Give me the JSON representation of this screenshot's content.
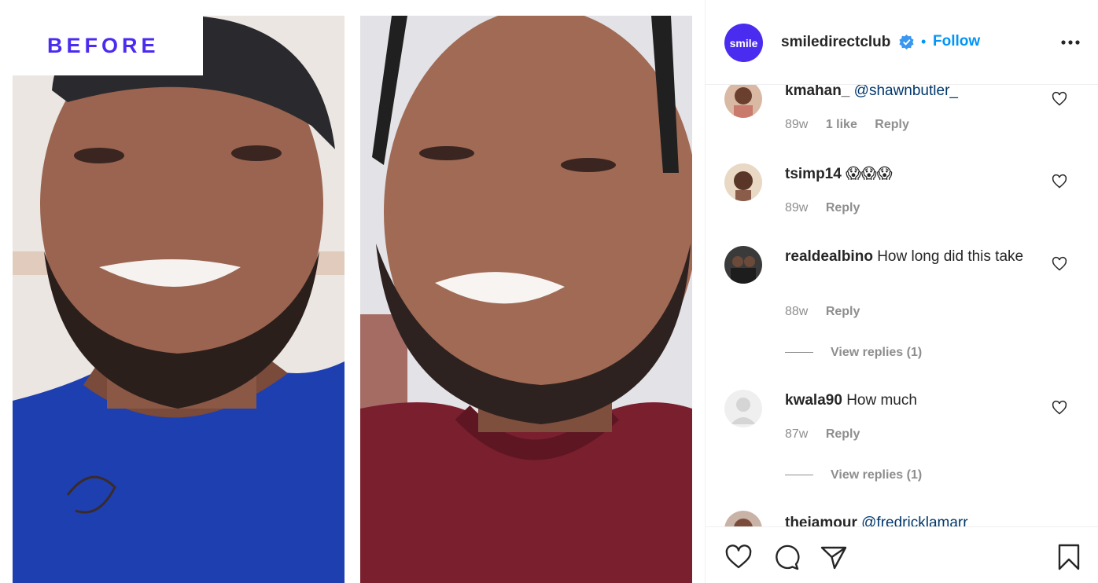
{
  "media": {
    "before_label": "BEFORE"
  },
  "header": {
    "avatar_text": "smile",
    "username": "smiledirectclub",
    "separator": "•",
    "follow_label": "Follow",
    "brand_color": "#4a2cf0",
    "link_color": "#0095f6"
  },
  "comments": [
    {
      "user": "kmahan_",
      "text": "@shawnbutler_",
      "time": "89w",
      "likes": "1 like",
      "reply": "Reply"
    },
    {
      "user": "tsimp14",
      "text": "😱😱😱",
      "time": "89w",
      "reply": "Reply"
    },
    {
      "user": "realdealbino",
      "text": "How long did this take",
      "time": "88w",
      "reply": "Reply",
      "view_replies": "View replies (1)"
    },
    {
      "user": "kwala90",
      "text": "How much",
      "time": "87w",
      "reply": "Reply",
      "view_replies": "View replies (1)"
    },
    {
      "user": "theiamour",
      "text": "@fredricklamarr"
    }
  ],
  "actions": {
    "icons": [
      "heart-icon",
      "comment-icon",
      "share-icon",
      "bookmark-icon"
    ]
  }
}
